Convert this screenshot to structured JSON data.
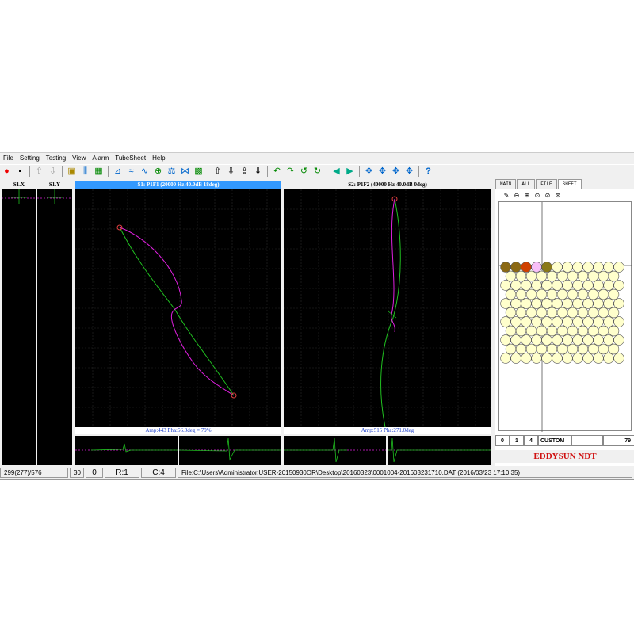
{
  "menu": [
    "File",
    "Setting",
    "Testing",
    "View",
    "Alarm",
    "TubeSheet",
    "Help"
  ],
  "left_headers": {
    "x": "S1.X",
    "y": "S1.Y"
  },
  "s1": {
    "title": "S1: P1F1 (20000 Hz 40.0dB 18deg)",
    "amp": "Amp:443  Pha:56.0deg = 79%"
  },
  "s2": {
    "title": "S2: P1F2 (40000 Hz 40.0dB 0deg)",
    "amp": "Amp:515  Pha:271.0deg"
  },
  "tabs": [
    "MAIN",
    "ALL",
    "FILE",
    "SHEET"
  ],
  "sheet_status": {
    "a": "0",
    "b": "1",
    "c": "4",
    "mode": "CUSTOM",
    "count": "79"
  },
  "brand": "EDDYSUN NDT",
  "status": {
    "pos": "299(277)/576",
    "n": "30",
    "zero": "0",
    "row": "R:1",
    "col": "C:4",
    "file": "File:C:\\Users\\Administrator.USER-20150930OR\\Desktop\\20160323\\0001004-201603231710.DAT (2016/03/23 17:10:35)"
  },
  "colors": {
    "signal1": "#e020e0",
    "signal2": "#20c020",
    "tube": "#ffffcc",
    "alarm": "#d04000",
    "mark": "#8b6914"
  }
}
